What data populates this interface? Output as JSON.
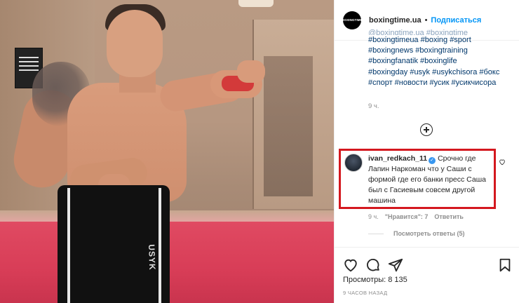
{
  "post": {
    "account": "boxingtime.ua",
    "avatar_text": "BOXINGTIME",
    "separator": "•",
    "follow_label": "Подписаться"
  },
  "caption": {
    "faded_line": "@boxingtime.ua   #boxingtime",
    "hashtags": [
      "#boxingtimeua #boxing #sport",
      "#boxingnews #boxingtraining",
      "#boxingfanatik #boxinglife",
      "#boxingday #usyk #usykchisora #бокс",
      "#спорт #новости #усик #усикчисора"
    ],
    "time": "9 ч."
  },
  "comment": {
    "username": "ivan_redkach_11",
    "verified_icon": "✓",
    "text": "Срочно где Лапин Наркоман что у Саши с формой где его банки пресс Саша был с Гасиевым совсем другой машина",
    "time": "9 ч.",
    "likes": "\"Нравится\": 7",
    "reply_label": "Ответить",
    "view_replies": "Посмотреть ответы (5)",
    "highlight_color": "#d4181f"
  },
  "footer": {
    "views_label": "Просмотры: 8 135",
    "posted_ago": "9 ЧАСОВ НАЗАД"
  },
  "media": {
    "shorts_text": "USYK"
  }
}
